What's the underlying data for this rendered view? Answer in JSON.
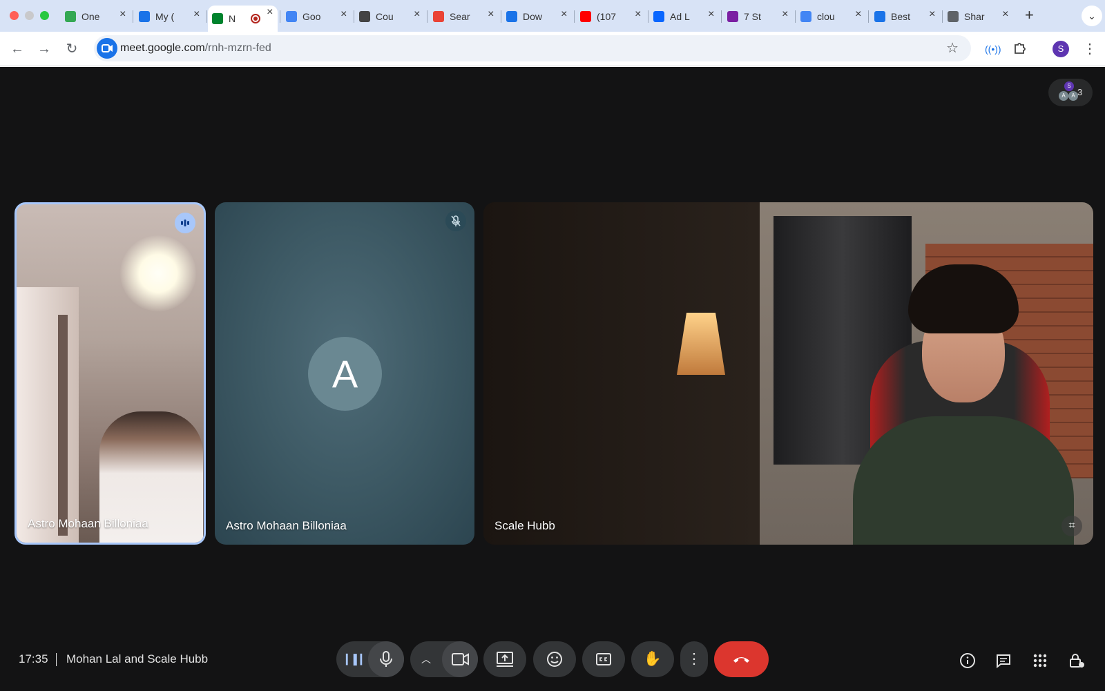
{
  "browser": {
    "tabs": [
      {
        "title": "One",
        "favicon_color": "#34a853",
        "favicon": "sheets-icon"
      },
      {
        "title": "My (",
        "favicon_color": "#1a73e8",
        "favicon": "circle-icon"
      },
      {
        "title": "N",
        "favicon_color": "#00832d",
        "favicon": "meet-icon",
        "recording": true
      },
      {
        "title": "Goo",
        "favicon_color": "#4285f4",
        "favicon": "docs-icon"
      },
      {
        "title": "Cou",
        "favicon_color": "#444444",
        "favicon": "openai-icon"
      },
      {
        "title": "Sear",
        "favicon_color": "#ea4335",
        "favicon": "gmail-icon"
      },
      {
        "title": "Dow",
        "favicon_color": "#1a73e8",
        "favicon": "download-icon"
      },
      {
        "title": "(107",
        "favicon_color": "#ff0000",
        "favicon": "youtube-icon"
      },
      {
        "title": "Ad L",
        "favicon_color": "#0866ff",
        "favicon": "meta-icon"
      },
      {
        "title": "7 St",
        "favicon_color": "#7b1fa2",
        "favicon": "badge-icon"
      },
      {
        "title": "clou",
        "favicon_color": "#4285f4",
        "favicon": "google-icon"
      },
      {
        "title": "Best",
        "favicon_color": "#1a73e8",
        "favicon": "chat-icon"
      },
      {
        "title": "Shar",
        "favicon_color": "#5f6368",
        "favicon": "globe-icon"
      }
    ],
    "new_tab": "+",
    "url_domain": "meet.google.com",
    "url_path": "/rnh-mzrn-fed",
    "profile_initial": "S"
  },
  "meet": {
    "participant_count": "3",
    "mini_avatars": [
      "S",
      "A",
      "A"
    ],
    "tiles": [
      {
        "name": "Astro Mohaan Billoniaa",
        "state": "speaking"
      },
      {
        "name": "Astro Mohaan Billoniaa",
        "state": "muted",
        "avatar_letter": "A"
      },
      {
        "name": "Scale Hubb",
        "state": "video"
      }
    ],
    "time": "17:35",
    "meeting_title": "Mohan Lal and Scale Hubb"
  },
  "colors": {
    "accent_blue": "#a8c7fa",
    "end_call": "#dc362e",
    "stage_bg": "#131314"
  }
}
